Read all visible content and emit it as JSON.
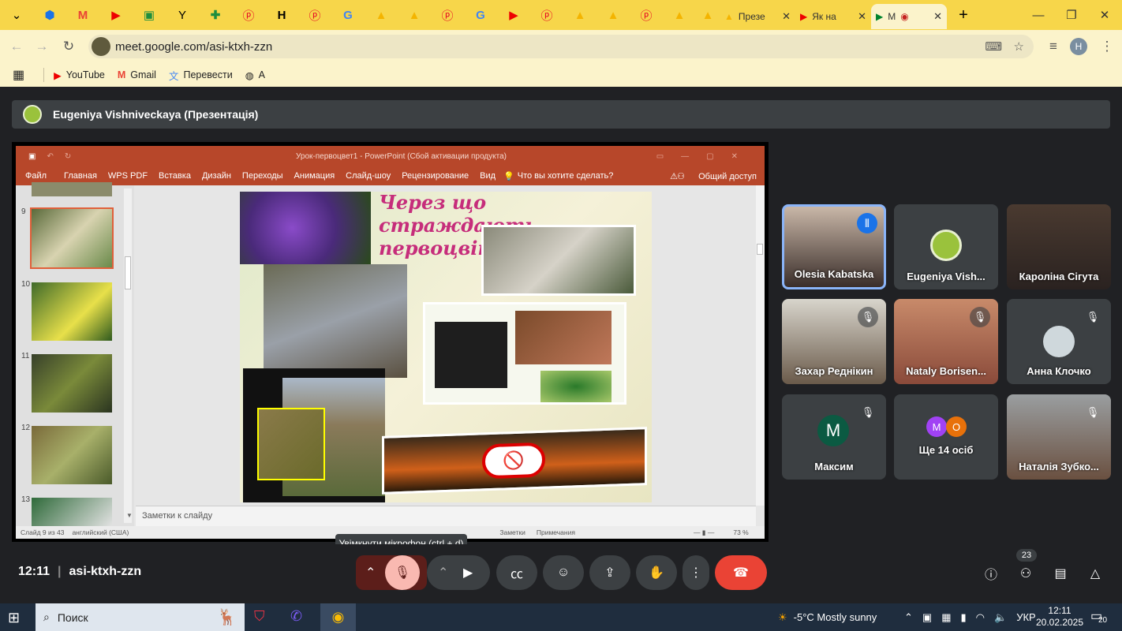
{
  "browser": {
    "tabs": [
      {
        "label": "",
        "icon": "chevron-down-icon"
      },
      {
        "label": "",
        "icon": "extension-icon"
      },
      {
        "label": "",
        "icon": "gmail-icon"
      },
      {
        "label": "",
        "icon": "youtube-icon"
      },
      {
        "label": "",
        "icon": "green-app-icon"
      },
      {
        "label": "",
        "icon": "y-icon"
      },
      {
        "label": "",
        "icon": "plus-green-icon"
      },
      {
        "label": "",
        "icon": "pinterest-icon"
      },
      {
        "label": "",
        "icon": "h-icon"
      },
      {
        "label": "",
        "icon": "pinterest-icon"
      },
      {
        "label": "",
        "icon": "google-icon"
      },
      {
        "label": "",
        "icon": "slides-icon"
      },
      {
        "label": "",
        "icon": "slides-icon"
      },
      {
        "label": "",
        "icon": "pinterest-icon"
      },
      {
        "label": "",
        "icon": "google-icon"
      },
      {
        "label": "",
        "icon": "youtube-icon"
      },
      {
        "label": "",
        "icon": "pinterest-icon"
      },
      {
        "label": "",
        "icon": "slides-icon"
      },
      {
        "label": "",
        "icon": "slides-icon"
      },
      {
        "label": "",
        "icon": "pinterest-icon"
      },
      {
        "label": "",
        "icon": "slides-icon"
      },
      {
        "label": "",
        "icon": "slides-icon"
      }
    ],
    "full_tabs": [
      {
        "label": "Презе",
        "icon": "slides-icon"
      },
      {
        "label": "Як на",
        "icon": "youtube-icon"
      },
      {
        "label": "М",
        "icon": "meet-icon"
      }
    ],
    "url": "meet.google.com/asi-ktxh-zzn",
    "bookmarks": [
      {
        "label": "YouTube",
        "icon": "youtube-icon"
      },
      {
        "label": "Gmail",
        "icon": "gmail-icon"
      },
      {
        "label": "Перевести",
        "icon": "translate-icon"
      },
      {
        "label": "A",
        "icon": "globe-icon"
      }
    ],
    "profile_initial": "H"
  },
  "meet": {
    "presenter": "Eugeniya Vishniveckaya (Презентація)",
    "ppt": {
      "title": "Урок-первоцвет1 - PowerPoint (Сбой активации продукта)",
      "ribbon": [
        "Файл",
        "Главная",
        "WPS PDF",
        "Вставка",
        "Дизайн",
        "Переходы",
        "Анимация",
        "Слайд-шоу",
        "Рецензирование",
        "Вид"
      ],
      "tell_me": "Что вы хотите сделать?",
      "share": "Общий доступ",
      "thumb_numbers": [
        "9",
        "10",
        "11",
        "12",
        "13"
      ],
      "slide_title": "Через що страждають первоцвіти",
      "notes": "Заметки к слайду",
      "status_left": "Слайд 9 из 43",
      "status_lang": "английский (США)",
      "status_notes": "Заметки",
      "status_comments": "Примечания",
      "zoom": "73 %"
    },
    "participants": [
      {
        "name": "Olesia Kabatska",
        "speaking": true
      },
      {
        "name": "Eugeniya Vish...",
        "speaking": false
      },
      {
        "name": "Кароліна Сігута",
        "speaking": false
      },
      {
        "name": "Захар Реднікин",
        "muted": true
      },
      {
        "name": "Nataly Borisen...",
        "muted": true
      },
      {
        "name": "Анна Клочко",
        "muted": true
      },
      {
        "name": "Максим",
        "initial": "M",
        "muted": true
      },
      {
        "name": "Ще 14 осіб",
        "initials": [
          "M",
          "O"
        ]
      },
      {
        "name": "Наталія Зубко...",
        "muted": true
      }
    ],
    "time": "12:11",
    "code": "asi-ktxh-zzn",
    "tooltip": "Увімкнути мікрофон (ctrl + d)",
    "people_count": "23"
  },
  "taskbar": {
    "search": "Поиск",
    "weather": "-5°C  Mostly sunny",
    "lang": "УКР",
    "time": "12:11",
    "date": "20.02.2025",
    "notifications": "20"
  },
  "colors": {
    "accent_red": "#ea4335",
    "ppt_red": "#b7472a",
    "meet_bg": "#202124",
    "tile": "#3c4043"
  }
}
